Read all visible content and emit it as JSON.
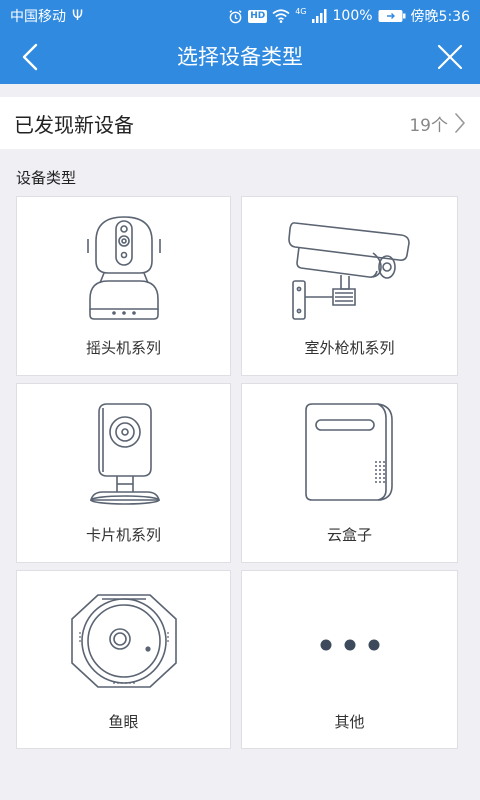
{
  "status_bar": {
    "carrier": "中国移动",
    "usb_symbol": "Ψ",
    "network": "4G",
    "battery": "100%",
    "time": "傍晚5:36",
    "icons": [
      "alarm-icon",
      "hd-icon",
      "wifi-icon",
      "signal-icon",
      "battery-icon"
    ],
    "hd_badge": "HD"
  },
  "nav": {
    "title": "选择设备类型",
    "back_icon": "chevron-left-icon",
    "close_icon": "close-icon"
  },
  "discovered": {
    "title": "已发现新设备",
    "count": "19个",
    "chevron_icon": "chevron-right-icon"
  },
  "section_label": "设备类型",
  "device_types": [
    {
      "label": "摇头机系列",
      "icon": "pan-tilt-camera-icon"
    },
    {
      "label": "室外枪机系列",
      "icon": "bullet-camera-icon"
    },
    {
      "label": "卡片机系列",
      "icon": "card-camera-icon"
    },
    {
      "label": "云盒子",
      "icon": "cloud-box-icon"
    },
    {
      "label": "鱼眼",
      "icon": "fisheye-camera-icon"
    },
    {
      "label": "其他",
      "icon": "more-icon"
    }
  ],
  "colors": {
    "header": "#2f8ae0",
    "background": "#efeff4",
    "icon_stroke": "#5b6472",
    "more_dots": "#3d4a5c"
  }
}
